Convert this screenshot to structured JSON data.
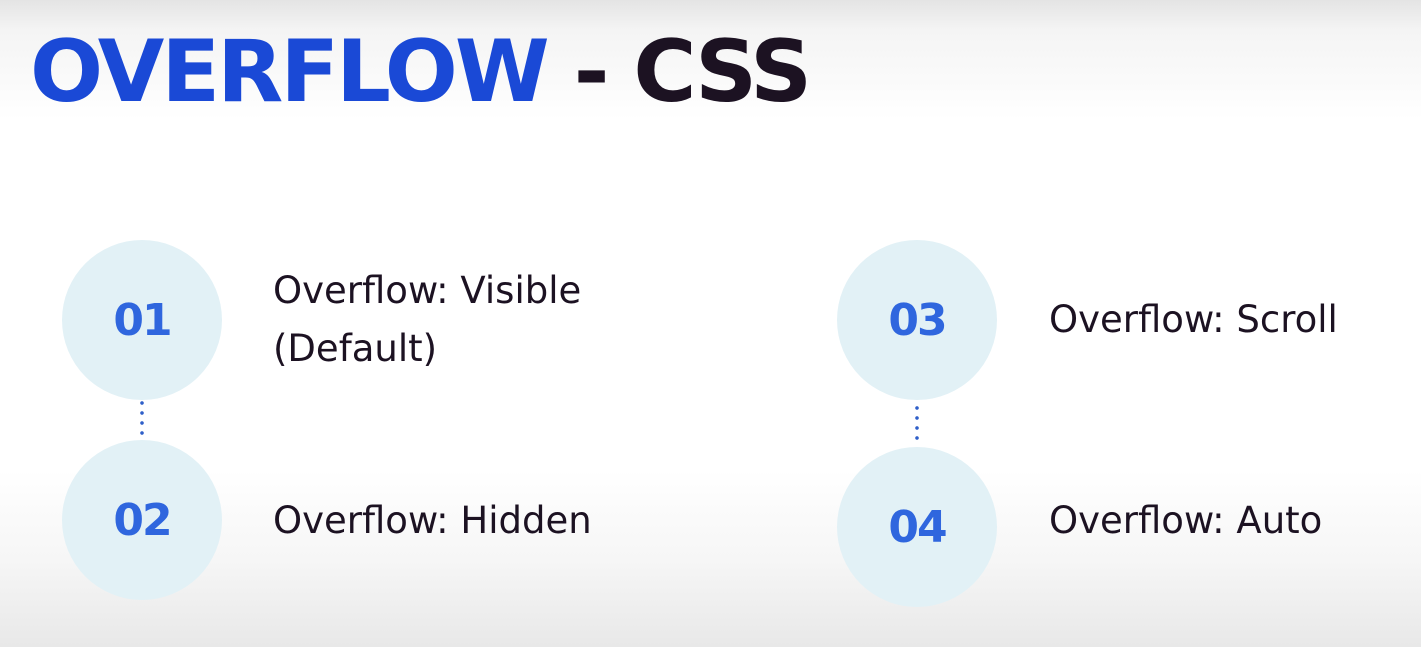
{
  "title": {
    "main": "OVERFLOW",
    "separator": " - ",
    "sub": "CSS"
  },
  "colors": {
    "title_accent": "#1a49d6",
    "title_dark": "#1c1222",
    "circle_fill": "#e2f1f6",
    "number_color": "#2f66de"
  },
  "items": [
    {
      "number": "01",
      "line1": "Overflow: Visible",
      "line2": "(Default)"
    },
    {
      "number": "02",
      "line1": "Overflow: Hidden"
    },
    {
      "number": "03",
      "line1": "Overflow: Scroll"
    },
    {
      "number": "04",
      "line1": "Overflow: Auto"
    }
  ]
}
